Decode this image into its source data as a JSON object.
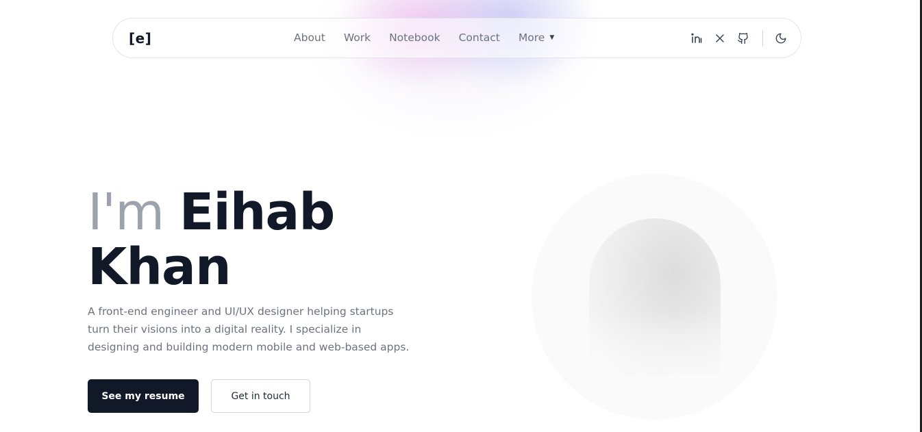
{
  "logo": "[e]",
  "nav": {
    "links": [
      "About",
      "Work",
      "Notebook",
      "Contact"
    ],
    "more_label": "More",
    "caret": "▼",
    "icons": [
      "linkedin-icon",
      "x-icon",
      "github-icon",
      "moon-icon"
    ]
  },
  "hero": {
    "greeting": "I'm ",
    "first_name": "Eihab",
    "last_name": "Khan",
    "description": "A front-end engineer and UI/UX designer helping startups turn their visions into a digital reality. I specialize in designing and building modern mobile and web-based apps.",
    "primary_button": "See my resume",
    "secondary_button": "Get in touch"
  },
  "colors": {
    "primary": "#111827",
    "muted_text": "#6b7280",
    "light_name": "#9ca3af",
    "avatar_bg": "#fafafa"
  }
}
